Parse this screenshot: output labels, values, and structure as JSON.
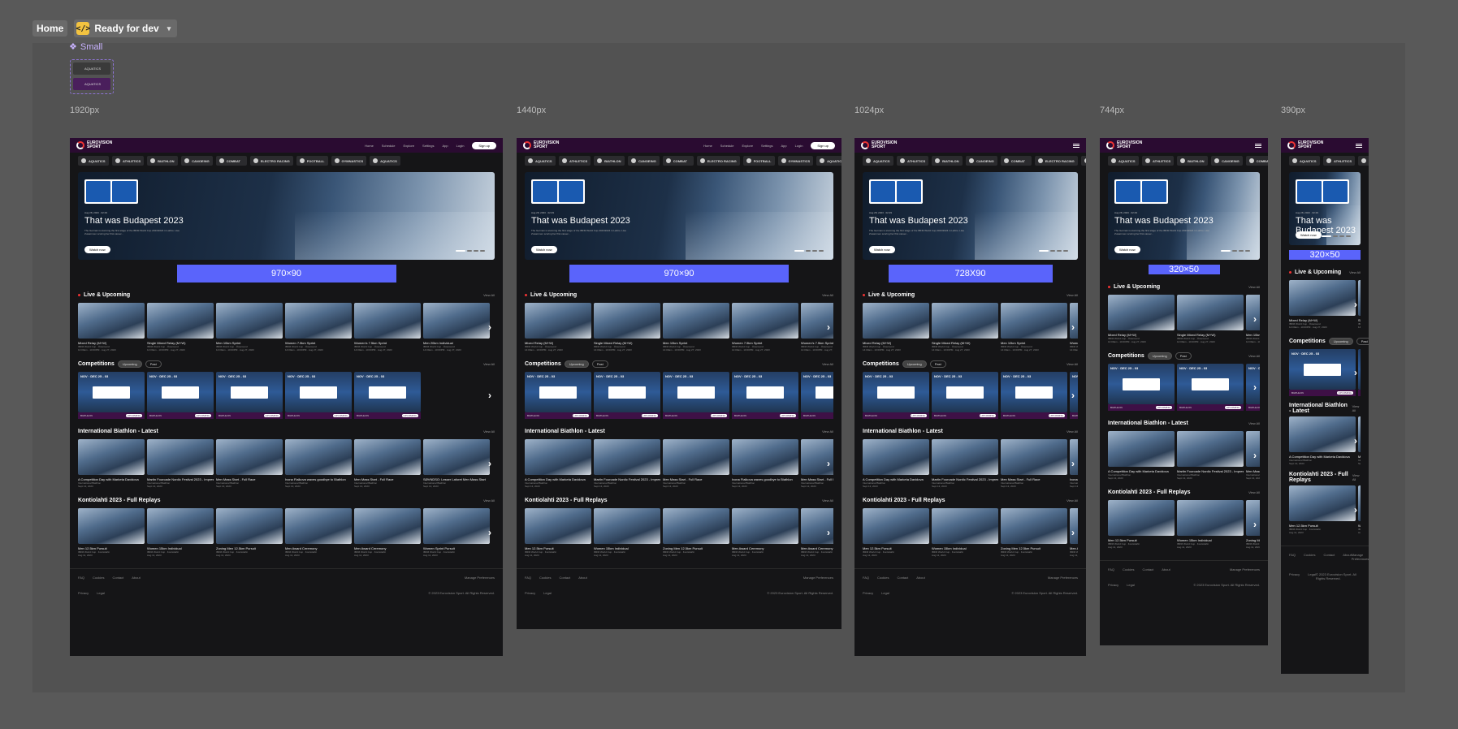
{
  "topbar": {
    "home": "Home",
    "status": "Ready for dev",
    "status_icon": "code-icon"
  },
  "component": {
    "name": "Small",
    "chip_label": "AQUATICS"
  },
  "frames": [
    {
      "label": "1920px",
      "ad": "970×90",
      "menu": "full"
    },
    {
      "label": "1440px",
      "ad": "970×90",
      "menu": "full"
    },
    {
      "label": "1024px",
      "ad": "728X90",
      "menu": "burger"
    },
    {
      "label": "744px",
      "ad": "320×50",
      "menu": "burger"
    },
    {
      "label": "390px",
      "ad": "320×50",
      "menu": "burger"
    }
  ],
  "nav": {
    "logo": "EUROVISION SPORT",
    "links": [
      "Home",
      "Schedule",
      "Explore",
      "Settings"
    ],
    "app": "App",
    "login": "Login",
    "signup": "Sign up"
  },
  "sports": [
    "AQUATICS",
    "ATHLETICS",
    "BIATHLON",
    "CANOEING",
    "COMBAT",
    "ELECTRO RACING",
    "FOOTBALL",
    "GYMNASTICS",
    "AQUATICS"
  ],
  "hero": {
    "meta": "Aug 28, 2023 · 02:29",
    "title": "That was Budapest 2023",
    "desc": "The German is storming the first stage of the IBFM World Cup 2023/2024 in Lahtio. Lisa Zusammen scoring her first career...",
    "watch": "Watch now"
  },
  "sections": {
    "live": "Live & Upcoming",
    "competitions": "Competitions",
    "upcoming": "Upcoming",
    "past": "Past",
    "latest": "International Biathlon - Latest",
    "replays": "Kontiolahti 2023 - Full Replays",
    "view_all": "View All"
  },
  "live_cards": [
    {
      "title": "Mixed Relay (M+W)",
      "sub": "IBFM World Cup · Östersund",
      "time": "14:00am - 10:00PM · Aug 27, 2023"
    },
    {
      "title": "Single Mixed Relay (M+W)",
      "sub": "IBFM World Cup · Östersund",
      "time": "14:00am - 10:00PM · Aug 27, 2023"
    },
    {
      "title": "Men 10km Sprint",
      "sub": "IBFM World Cup · Östersund",
      "time": "14:00am - 10:00PM · Aug 27, 2023"
    },
    {
      "title": "Women 7.5km Sprint",
      "sub": "IBFM World Cup · Östersund",
      "time": "14:00am - 10:00PM · Aug 27, 2023"
    },
    {
      "title": "Women's 7.5km Sprint",
      "sub": "IBFM World Cup · Östersund",
      "time": "14:00am - 10:00PM · Aug 27, 2023"
    },
    {
      "title": "Men 20km Individual",
      "sub": "IBFM World Cup · Östersund",
      "time": "14:00am - 10:00PM · Aug 27, 2023"
    }
  ],
  "comp_cards": [
    {
      "date": "NOV · DEC 25 - 03",
      "sport": "BIATHLON",
      "tag": "UPCOMING"
    },
    {
      "date": "NOV · DEC 25 - 03",
      "sport": "BIATHLON",
      "tag": "UPCOMING"
    },
    {
      "date": "NOV · DEC 25 - 03",
      "sport": "BIATHLON",
      "tag": "UPCOMING"
    },
    {
      "date": "NOV · DEC 25 - 03",
      "sport": "BIATHLON",
      "tag": "UPCOMING"
    },
    {
      "date": "NOV · DEC 25 - 03",
      "sport": "BIATHLON",
      "tag": "UPCOMING"
    }
  ],
  "latest_cards": [
    {
      "title": "A Competition Day with Marketa Davidova",
      "sub": "International Biathlon",
      "time": "Sept 13, 2023"
    },
    {
      "title": "Martin Fourcade Nordic Festival 2023 - Impressions from Annecy",
      "sub": "International Biathlon",
      "time": "Sept 13, 2023"
    },
    {
      "title": "Men Mass Start - Full Race",
      "sub": "International Biathlon",
      "time": "Sept 13, 2023"
    },
    {
      "title": "Ivona Fialkova waves goodbye to Biathlon",
      "sub": "International Biathlon",
      "time": "Sept 13, 2023"
    },
    {
      "title": "Men Mass Start - Full Race",
      "sub": "International Biathlon",
      "time": "Sept 13, 2023"
    },
    {
      "title": "SØVNDSO: Lesser Laforet Men Mass Start",
      "sub": "International Biathlon",
      "time": "Sept 13, 2023"
    }
  ],
  "replay_cards": [
    {
      "title": "Men 12.5km Pursuit",
      "sub": "IBFM World Cup · Kontiolahti",
      "time": "Aug 11, 2023"
    },
    {
      "title": "Women 15km Individual",
      "sub": "IBFM World Cup · Kontiolahti",
      "time": "Aug 11, 2023"
    },
    {
      "title": "Zoning Men 12.5km Pursuit",
      "sub": "IBFM World Cup · Kontiolahti",
      "time": "Aug 11, 2023"
    },
    {
      "title": "Men Award Ceremony",
      "sub": "IBFM World Cup · Kontiolahti",
      "time": "Aug 11, 2023"
    },
    {
      "title": "Men Award Ceremony",
      "sub": "IBFM World Cup · Kontiolahti",
      "time": "Aug 11, 2023"
    },
    {
      "title": "Women Sprint Pursuit",
      "sub": "IBFM World Cup · Kontiolahti",
      "time": "Aug 11, 2023"
    }
  ],
  "footer": {
    "links": [
      "FAQ",
      "Cookies",
      "Contact",
      "About"
    ],
    "manage": "Manage Preferences",
    "legal": [
      "Privacy",
      "Legal"
    ],
    "copyright": "© 2023 Eurovision Sport. All Rights Reserved."
  }
}
